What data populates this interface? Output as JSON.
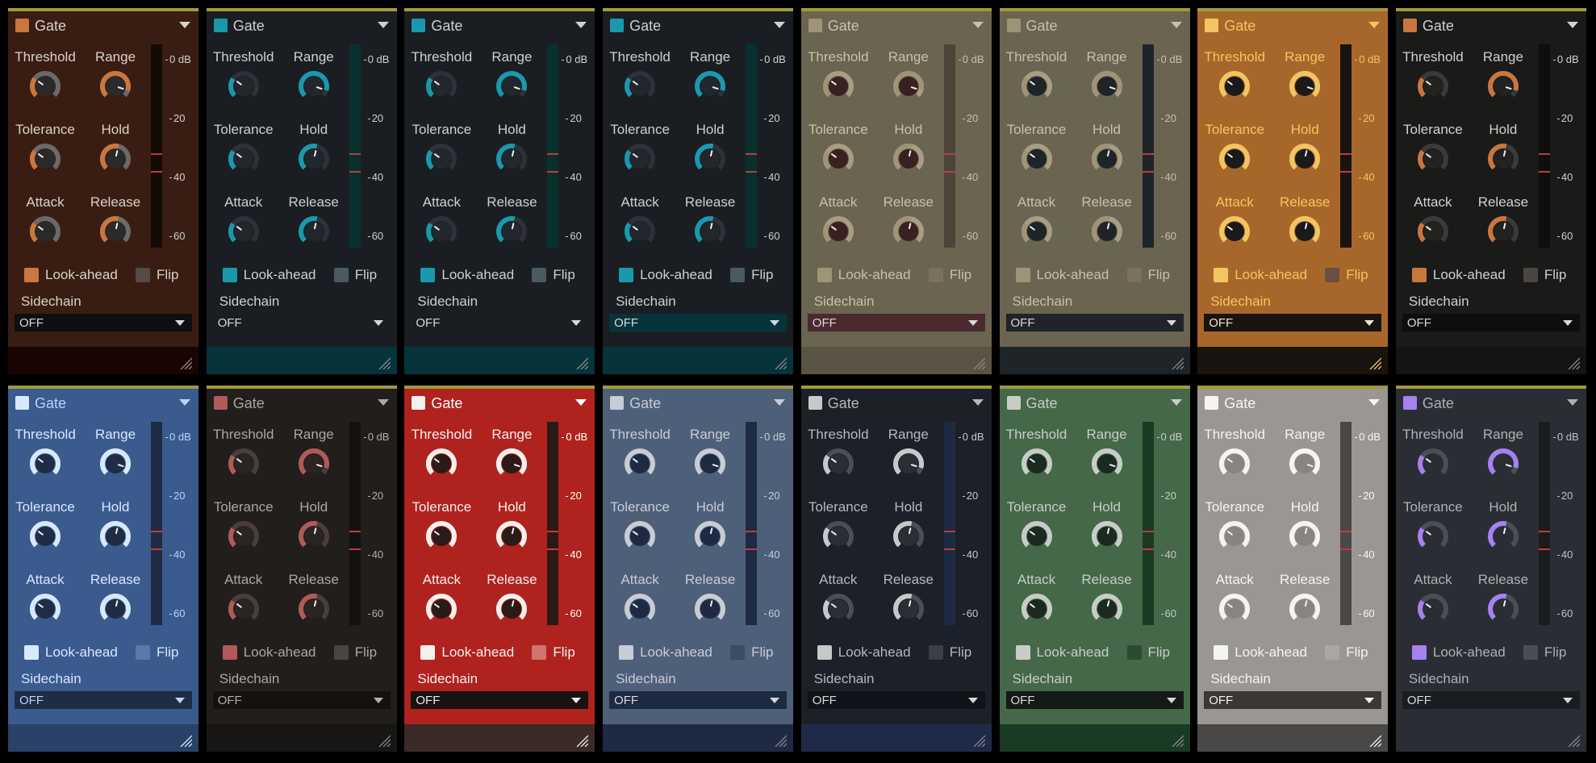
{
  "labels": {
    "title": "Gate",
    "threshold": "Threshold",
    "range": "Range",
    "tolerance": "Tolerance",
    "hold": "Hold",
    "attack": "Attack",
    "release": "Release",
    "lookahead": "Look-ahead",
    "flip": "Flip",
    "sidechain": "Sidechain",
    "sidechain_value": "OFF"
  },
  "meter_ticks": [
    "0 dB",
    "20",
    "40",
    "60"
  ],
  "knob_levels": {
    "threshold": 0.3,
    "range": 0.9,
    "tolerance": 0.3,
    "hold": 0.55,
    "attack": 0.3,
    "release": 0.55
  },
  "themes": [
    {
      "name": "copper",
      "bg": "#3a1d12",
      "header": "#3a1d12",
      "topbar": "#a09a3a",
      "accent": "#c9773e",
      "text": "#d9d2c8",
      "dim": "#3c2a22",
      "knobbody": "#6a6a6a",
      "knobcenter": "#2a2a2a",
      "meter": "#140a06",
      "ticktext": "#d0d0d0",
      "sel": "#0f0f0f",
      "seltext": "#d8d8d8",
      "foot": "#1a0504",
      "flipbox": "#544a46",
      "labelaccent": false
    },
    {
      "name": "teal",
      "bg": "#1a1e22",
      "header": "#1a1e22",
      "topbar": "#a09a3a",
      "accent": "#1a99ad",
      "text": "#cfcfcf",
      "dim": "#2c3238",
      "knobbody": "#2c3238",
      "knobcenter": "#22272c",
      "meter": "#07302f",
      "ticktext": "#d0d0d0",
      "sel": "#1a1e22",
      "seltext": "#d8d8d8",
      "foot": "#06343a",
      "flipbox": "#4a5a60",
      "labelaccent": false
    },
    {
      "name": "teal",
      "bg": "#1a1e22",
      "header": "#1a1e22",
      "topbar": "#a09a3a",
      "accent": "#1a99ad",
      "text": "#cfcfcf",
      "dim": "#2c3238",
      "knobbody": "#2c3238",
      "knobcenter": "#22272c",
      "meter": "#07302f",
      "ticktext": "#d0d0d0",
      "sel": "#1a1e22",
      "seltext": "#d8d8d8",
      "foot": "#06343a",
      "flipbox": "#4a5a60",
      "labelaccent": false
    },
    {
      "name": "teal",
      "bg": "#1a1e22",
      "header": "#1a1e22",
      "topbar": "#a09a3a",
      "accent": "#1a99ad",
      "text": "#cfcfcf",
      "dim": "#2c3238",
      "knobbody": "#2c3238",
      "knobcenter": "#22272c",
      "meter": "#07302f",
      "ticktext": "#d0d0d0",
      "sel": "#06343a",
      "seltext": "#d8d8d8",
      "foot": "#06343a",
      "flipbox": "#4a5a60",
      "labelaccent": false
    },
    {
      "name": "olive",
      "bg": "#6b6450",
      "header": "#6b6450",
      "topbar": "#a09a3a",
      "accent": "#a09478",
      "text": "#c8c0a8",
      "dim": "#837a62",
      "knobbody": "#a89e84",
      "knobcenter": "#3a2020",
      "meter": "#4a4538",
      "ticktext": "#c8c0a8",
      "sel": "#4a2a2e",
      "seltext": "#d8d8d8",
      "foot": "#5a5444",
      "flipbox": "#7a725e",
      "labelaccent": false
    },
    {
      "name": "olive-dark",
      "bg": "#6b6450",
      "header": "#6b6450",
      "topbar": "#a09a3a",
      "accent": "#a09478",
      "text": "#c8c0a8",
      "dim": "#837a62",
      "knobbody": "#a89e84",
      "knobcenter": "#1e2428",
      "meter": "#1e2428",
      "ticktext": "#c8c0a8",
      "sel": "#1e2428",
      "seltext": "#d8d8d8",
      "foot": "#1e2428",
      "flipbox": "#7a725e",
      "labelaccent": false
    },
    {
      "name": "gold",
      "bg": "#a8672a",
      "header": "#a8672a",
      "topbar": "#a09a3a",
      "accent": "#f2c562",
      "text": "#f2c562",
      "dim": "#8a5420",
      "knobbody": "#f2c562",
      "knobcenter": "#1a1a1a",
      "meter": "#1a1410",
      "ticktext": "#f2c562",
      "sel": "#1a1410",
      "seltext": "#f2e6c8",
      "foot": "#1a1410",
      "flipbox": "#6a5040",
      "labelaccent": true
    },
    {
      "name": "copper-dark",
      "bg": "#1a1a18",
      "header": "#1a1a18",
      "topbar": "#a09a3a",
      "accent": "#c9773e",
      "text": "#d0d0d0",
      "dim": "#2a2a28",
      "knobbody": "#3a3a38",
      "knobcenter": "#222220",
      "meter": "#0e0e0c",
      "ticktext": "#d0d0d0",
      "sel": "#0e0e0c",
      "seltext": "#d8d8d8",
      "foot": "#141412",
      "flipbox": "#4a4644",
      "labelaccent": false
    },
    {
      "name": "blue",
      "bg": "#3b5a8e",
      "header": "#3b5a8e",
      "topbar": "#a09a3a",
      "accent": "#d8e8ff",
      "text": "#b8d4ff",
      "dim": "#2c4670",
      "knobbody": "#d8e8ff",
      "knobcenter": "#1e2c44",
      "meter": "#1e2c44",
      "ticktext": "#b8d4ff",
      "sel": "#1e2c44",
      "seltext": "#b8d4ff",
      "foot": "#2a4268",
      "flipbox": "#5a78a8",
      "labelaccent": true
    },
    {
      "name": "rose-dark",
      "bg": "#221e1c",
      "header": "#221e1c",
      "topbar": "#a09a3a",
      "accent": "#b05a5a",
      "text": "#a8a8a8",
      "dim": "#38302e",
      "knobbody": "#4a3e3c",
      "knobcenter": "#2a2422",
      "meter": "#141210",
      "ticktext": "#b0b0b0",
      "sel": "#141210",
      "seltext": "#b0b0b0",
      "foot": "#181614",
      "flipbox": "#4a4442",
      "labelaccent": false
    },
    {
      "name": "red",
      "bg": "#b0221e",
      "header": "#b0221e",
      "topbar": "#a09a3a",
      "accent": "#f4f0ee",
      "text": "#ffffff",
      "dim": "#8a1a16",
      "knobbody": "#f4f0ee",
      "knobcenter": "#2a1a18",
      "meter": "#2a1a18",
      "ticktext": "#ffffff",
      "sel": "#1a1210",
      "seltext": "#f0e8e6",
      "foot": "#3a2a28",
      "flipbox": "#d07470",
      "labelaccent": true
    },
    {
      "name": "slate",
      "bg": "#4e5f7a",
      "header": "#4e5f7a",
      "topbar": "#a09a3a",
      "accent": "#c8ccd4",
      "text": "#c8ccd4",
      "dim": "#3e4c62",
      "knobbody": "#c8ccd4",
      "knobcenter": "#1e2a44",
      "meter": "#1e2a44",
      "ticktext": "#c8ccd4",
      "sel": "#1e2a44",
      "seltext": "#d8d8d8",
      "foot": "#1e2a44",
      "flipbox": "#3e4c62",
      "labelaccent": false
    },
    {
      "name": "navy",
      "bg": "#1c2028",
      "header": "#1c2028",
      "topbar": "#a09a3a",
      "accent": "#c8c8c8",
      "text": "#b8b8b8",
      "dim": "#2c323c",
      "knobbody": "#4a4e56",
      "knobcenter": "#2a2e36",
      "meter": "#1e2a44",
      "ticktext": "#c8c8c8",
      "sel": "#101418",
      "seltext": "#d8d8d8",
      "foot": "#1e2a48",
      "flipbox": "#3a3e46",
      "labelaccent": false
    },
    {
      "name": "green",
      "bg": "#456848",
      "header": "#456848",
      "topbar": "#a09a3a",
      "accent": "#c8ccc8",
      "text": "#c8ccc8",
      "dim": "#2e4a30",
      "knobbody": "#c8ccc8",
      "knobcenter": "#1a2a20",
      "meter": "#1a3a24",
      "ticktext": "#c8ccc8",
      "sel": "#141a16",
      "seltext": "#d8d8d8",
      "foot": "#1a3a24",
      "flipbox": "#2e4a30",
      "labelaccent": false
    },
    {
      "name": "silver",
      "bg": "#9a9692",
      "header": "#9a9692",
      "topbar": "#a09a3a",
      "accent": "#f4f4f4",
      "text": "#f8f8f8",
      "dim": "#7e7a76",
      "knobbody": "#f4f4f4",
      "knobcenter": "#888480",
      "meter": "#4a4846",
      "ticktext": "#f8f8f8",
      "sel": "#3a3836",
      "seltext": "#f0f0f0",
      "foot": "#4a4846",
      "flipbox": "#aaa6a2",
      "labelaccent": true
    },
    {
      "name": "violet",
      "bg": "#2a2e34",
      "header": "#2a2e34",
      "topbar": "#a09a3a",
      "accent": "#a582f0",
      "text": "#b0b0b0",
      "dim": "#3a3e44",
      "knobbody": "#4a4e56",
      "knobcenter": "#2a2e34",
      "meter": "#1a1c20",
      "ticktext": "#c0c0c0",
      "sel": "#1a1c20",
      "seltext": "#d8d8d8",
      "foot": "#2a2e34",
      "flipbox": "#4a4e54",
      "labelaccent": false
    }
  ]
}
